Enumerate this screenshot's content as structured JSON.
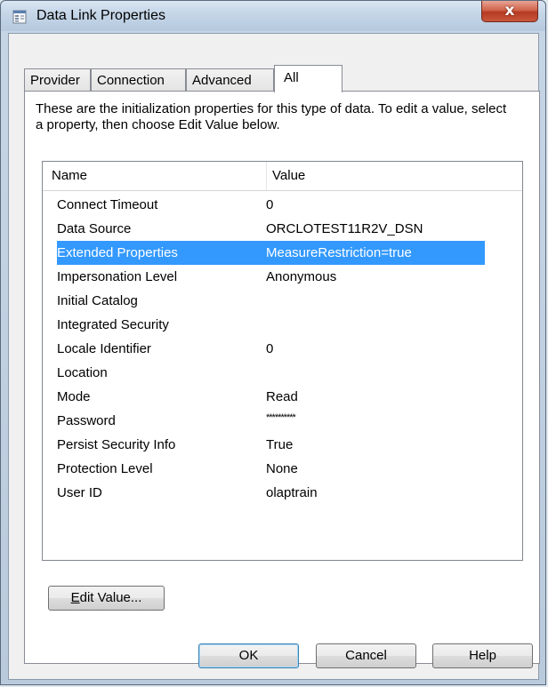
{
  "window": {
    "title": "Data Link Properties",
    "close_symbol": "x",
    "colors": {
      "titlebar": "#c4d5e7",
      "close": "#c9573c",
      "selection": "#3399ff"
    }
  },
  "tabs": [
    {
      "label": "Provider",
      "active": false
    },
    {
      "label": "Connection",
      "active": false
    },
    {
      "label": "Advanced",
      "active": false
    },
    {
      "label": "All",
      "active": true
    }
  ],
  "panel": {
    "description": "These are the initialization properties for this type of data. To edit a value, select a property, then choose Edit Value below.",
    "columns": {
      "name": "Name",
      "value": "Value"
    },
    "properties": [
      {
        "name": "Connect Timeout",
        "value": "0"
      },
      {
        "name": "Data Source",
        "value": "ORCLOTEST11R2V_DSN"
      },
      {
        "name": "Extended Properties",
        "value": "MeasureRestriction=true",
        "selected": true
      },
      {
        "name": "Impersonation Level",
        "value": "Anonymous"
      },
      {
        "name": "Initial Catalog",
        "value": ""
      },
      {
        "name": "Integrated Security",
        "value": ""
      },
      {
        "name": "Locale Identifier",
        "value": "0"
      },
      {
        "name": "Location",
        "value": ""
      },
      {
        "name": "Mode",
        "value": "Read"
      },
      {
        "name": "Password",
        "value": "**********"
      },
      {
        "name": "Persist Security Info",
        "value": "True"
      },
      {
        "name": "Protection Level",
        "value": "None"
      },
      {
        "name": "User ID",
        "value": "olaptrain"
      }
    ],
    "edit_value": {
      "mnemonic": "E",
      "rest": "dit Value..."
    }
  },
  "buttons": {
    "ok": "OK",
    "cancel": "Cancel",
    "help": "Help"
  }
}
